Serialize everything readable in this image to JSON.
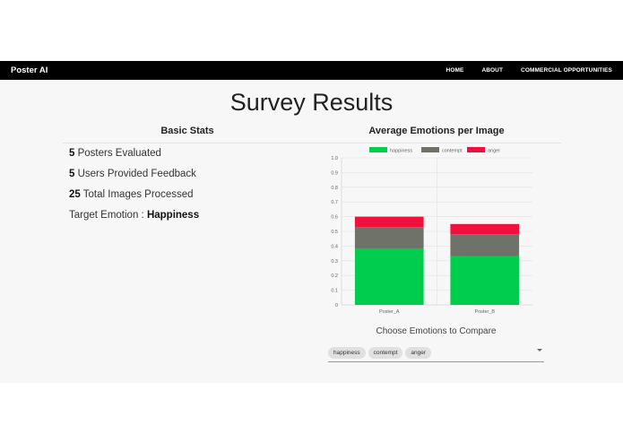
{
  "nav": {
    "brand": "Poster AI",
    "links": [
      "HOME",
      "ABOUT",
      "COMMERCIAL OPPORTUNITIES"
    ]
  },
  "title": "Survey Results",
  "basic_stats": {
    "heading": "Basic Stats",
    "posters_count": "5",
    "posters_label": " Posters Evaluated",
    "users_count": "5",
    "users_label": " Users Provided Feedback",
    "images_count": "25",
    "images_label": " Total Images Processed",
    "emotion_label": "Target Emotion : ",
    "emotion_value": "Happiness"
  },
  "chart_heading": "Average Emotions per Image",
  "chart_data": {
    "type": "bar",
    "stacked": true,
    "categories": [
      "Poster_A",
      "Poster_B"
    ],
    "series": [
      {
        "name": "happiness",
        "color": "#00cc4d",
        "values": [
          0.38,
          0.33
        ]
      },
      {
        "name": "contempt",
        "color": "#6f7268",
        "values": [
          0.15,
          0.15
        ]
      },
      {
        "name": "anger",
        "color": "#f0103d",
        "values": [
          0.07,
          0.07
        ]
      }
    ],
    "ylim": [
      0,
      1.0
    ],
    "yticks": [
      "0",
      "0.1",
      "0.2",
      "0.3",
      "0.4",
      "0.5",
      "0.6",
      "0.7",
      "0.8",
      "0.9",
      "1.0"
    ],
    "legend_position": "top",
    "grid": true
  },
  "compare": {
    "label": "Choose Emotions to Compare",
    "chips": [
      "happiness",
      "contempt",
      "anger"
    ]
  }
}
